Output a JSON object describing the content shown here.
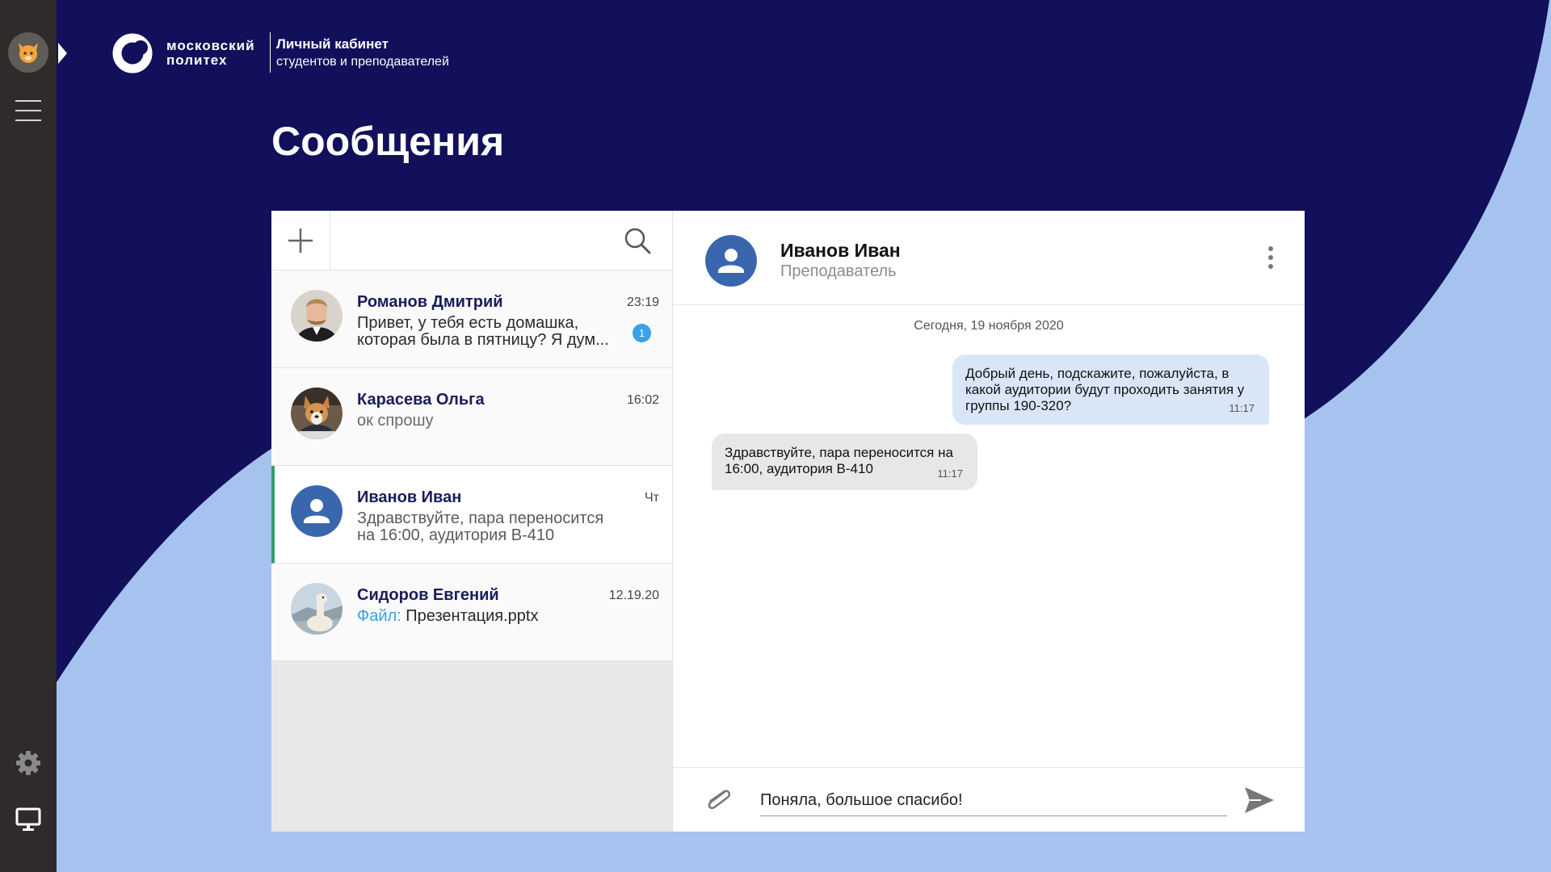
{
  "app": {
    "logo_line1": "московский",
    "logo_line2": "политех",
    "cabinet_title": "Личный кабинет",
    "cabinet_subtitle": "студентов и преподавателей",
    "page_title": "Сообщения"
  },
  "colors": {
    "navy": "#12105b",
    "light_blue": "#a5c3ee",
    "rail": "#2e2b2a",
    "accent_green": "#2f9e6a",
    "badge_blue": "#3aa1e6"
  },
  "conversations": [
    {
      "name": "Романов Дмитрий",
      "time": "23:19",
      "preview": "Привет, у тебя есть домашка, которая была в пятницу? Я дум...",
      "unread": "1",
      "avatar": "photo-man"
    },
    {
      "name": "Карасева Ольга",
      "time": "16:02",
      "preview": "ок спрошу",
      "avatar": "photo-dog"
    },
    {
      "name": "Иванов Иван",
      "time": "Чт",
      "preview": "Здравствуйте, пара переносится на 16:00, аудитория В-410",
      "avatar": "default-user",
      "active": true
    },
    {
      "name": "Сидоров Евгений",
      "time": "12.19.20",
      "preview_label": "Файл:",
      "preview": "Презентация.pptx",
      "avatar": "photo-alpaca"
    }
  ],
  "chat": {
    "name": "Иванов Иван",
    "role": "Преподаватель",
    "date": "Сегодня, 19 ноября 2020",
    "messages": [
      {
        "dir": "out",
        "text": "Добрый день, подскажите, пожалуйста, в какой аудитории будут проходить занятия у группы 190-320?",
        "time": "11:17"
      },
      {
        "dir": "in",
        "text": "Здравствуйте, пара переносится на 16:00, аудитория В-410",
        "time": "11:17"
      }
    ],
    "composer_value": "Поняла, большое спасибо!"
  },
  "icons": [
    "cat-avatar-icon",
    "menu-icon",
    "gear-icon",
    "monitor-icon",
    "plus-icon",
    "search-icon",
    "more-vertical-icon",
    "paperclip-icon",
    "send-icon"
  ]
}
